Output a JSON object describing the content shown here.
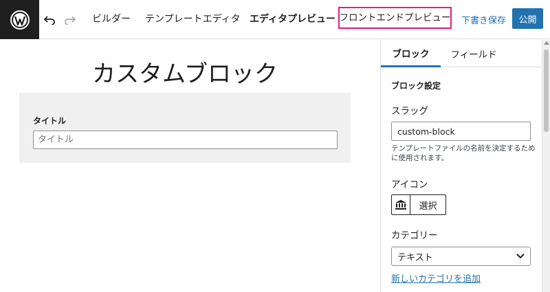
{
  "topbar": {
    "logo_icon": "wordpress-logo-icon",
    "undo_icon": "undo-icon",
    "redo_icon": "redo-icon",
    "nav": {
      "builder": "ビルダー",
      "template_editor": "テンプレートエディタ",
      "editor_preview": "エディタプレビュー",
      "front_preview": "フロントエンドプレビュー"
    },
    "save_draft": "下書き保存",
    "publish": "公開",
    "highlight_color": "#e6197a",
    "accent_color": "#2271b1"
  },
  "editor": {
    "block_title": "カスタムブロック",
    "field_label": "タイトル",
    "field_placeholder": "タイトル"
  },
  "sidebar": {
    "tabs": [
      {
        "label": "ブロック",
        "active": true
      },
      {
        "label": "フィールド",
        "active": false
      }
    ],
    "section_heading": "ブロック設定",
    "slug_label": "スラッグ",
    "slug_value": "custom-block",
    "slug_help": "テンプレートファイルの名前を決定するために使用されます。",
    "icon_label": "アイコン",
    "icon_name": "bank-icon",
    "icon_select": "選択",
    "category_label": "カテゴリー",
    "category_value": "テキスト",
    "add_category": "新しいカテゴリを追加"
  }
}
